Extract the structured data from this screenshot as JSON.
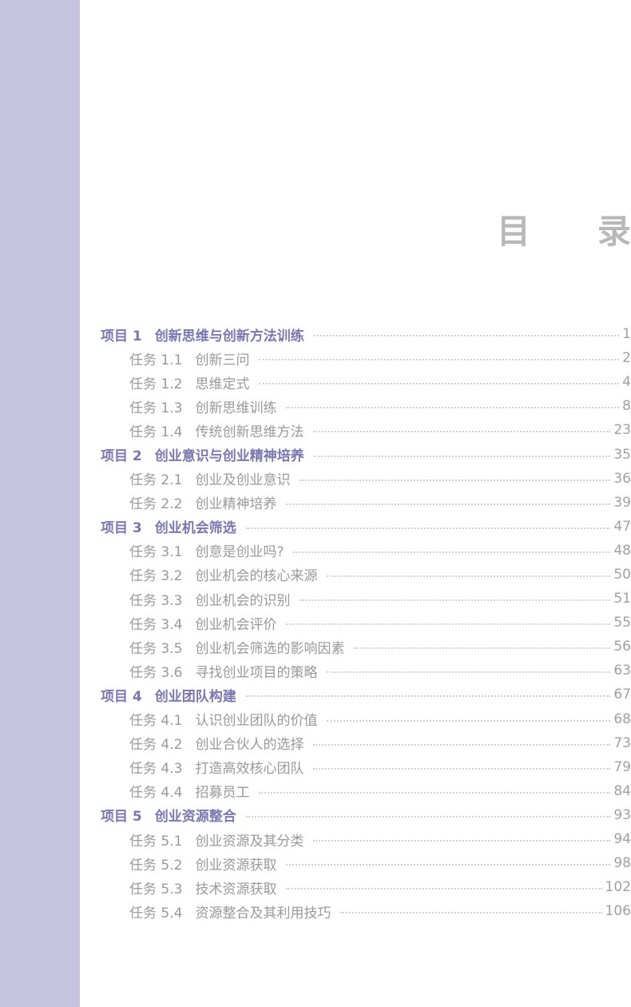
{
  "title": {
    "char1": "目",
    "char2": "录"
  },
  "toc": [
    {
      "type": "chapter",
      "num": "项目 1",
      "title": "创新思维与创新方法训练",
      "page": "1"
    },
    {
      "type": "section",
      "num": "任务 1.1",
      "title": "创新三问",
      "page": "2"
    },
    {
      "type": "section",
      "num": "任务 1.2",
      "title": "思维定式",
      "page": "4"
    },
    {
      "type": "section",
      "num": "任务 1.3",
      "title": "创新思维训练",
      "page": "8"
    },
    {
      "type": "section",
      "num": "任务 1.4",
      "title": "传统创新思维方法",
      "page": "23"
    },
    {
      "type": "chapter",
      "num": "项目 2",
      "title": "创业意识与创业精神培养",
      "page": "35"
    },
    {
      "type": "section",
      "num": "任务 2.1",
      "title": "创业及创业意识",
      "page": "36"
    },
    {
      "type": "section",
      "num": "任务 2.2",
      "title": "创业精神培养",
      "page": "39"
    },
    {
      "type": "chapter",
      "num": "项目 3",
      "title": "创业机会筛选",
      "page": "47"
    },
    {
      "type": "section",
      "num": "任务 3.1",
      "title": "创意是创业吗?",
      "page": "48"
    },
    {
      "type": "section",
      "num": "任务 3.2",
      "title": "创业机会的核心来源",
      "page": "50"
    },
    {
      "type": "section",
      "num": "任务 3.3",
      "title": "创业机会的识别",
      "page": "51"
    },
    {
      "type": "section",
      "num": "任务 3.4",
      "title": "创业机会评价",
      "page": "55"
    },
    {
      "type": "section",
      "num": "任务 3.5",
      "title": "创业机会筛选的影响因素",
      "page": "56"
    },
    {
      "type": "section",
      "num": "任务 3.6",
      "title": "寻找创业项目的策略",
      "page": "63"
    },
    {
      "type": "chapter",
      "num": "项目 4",
      "title": "创业团队构建",
      "page": "67"
    },
    {
      "type": "section",
      "num": "任务 4.1",
      "title": "认识创业团队的价值",
      "page": "68"
    },
    {
      "type": "section",
      "num": "任务 4.2",
      "title": "创业合伙人的选择",
      "page": "73"
    },
    {
      "type": "section",
      "num": "任务 4.3",
      "title": "打造高效核心团队",
      "page": "79"
    },
    {
      "type": "section",
      "num": "任务 4.4",
      "title": "招募员工",
      "page": "84"
    },
    {
      "type": "chapter",
      "num": "项目 5",
      "title": "创业资源整合",
      "page": "93"
    },
    {
      "type": "section",
      "num": "任务 5.1",
      "title": "创业资源及其分类",
      "page": "94"
    },
    {
      "type": "section",
      "num": "任务 5.2",
      "title": "创业资源获取",
      "page": "98"
    },
    {
      "type": "section",
      "num": "任务 5.3",
      "title": "技术资源获取",
      "page": "102"
    },
    {
      "type": "section",
      "num": "任务 5.4",
      "title": "资源整合及其利用技巧",
      "page": "106"
    }
  ]
}
